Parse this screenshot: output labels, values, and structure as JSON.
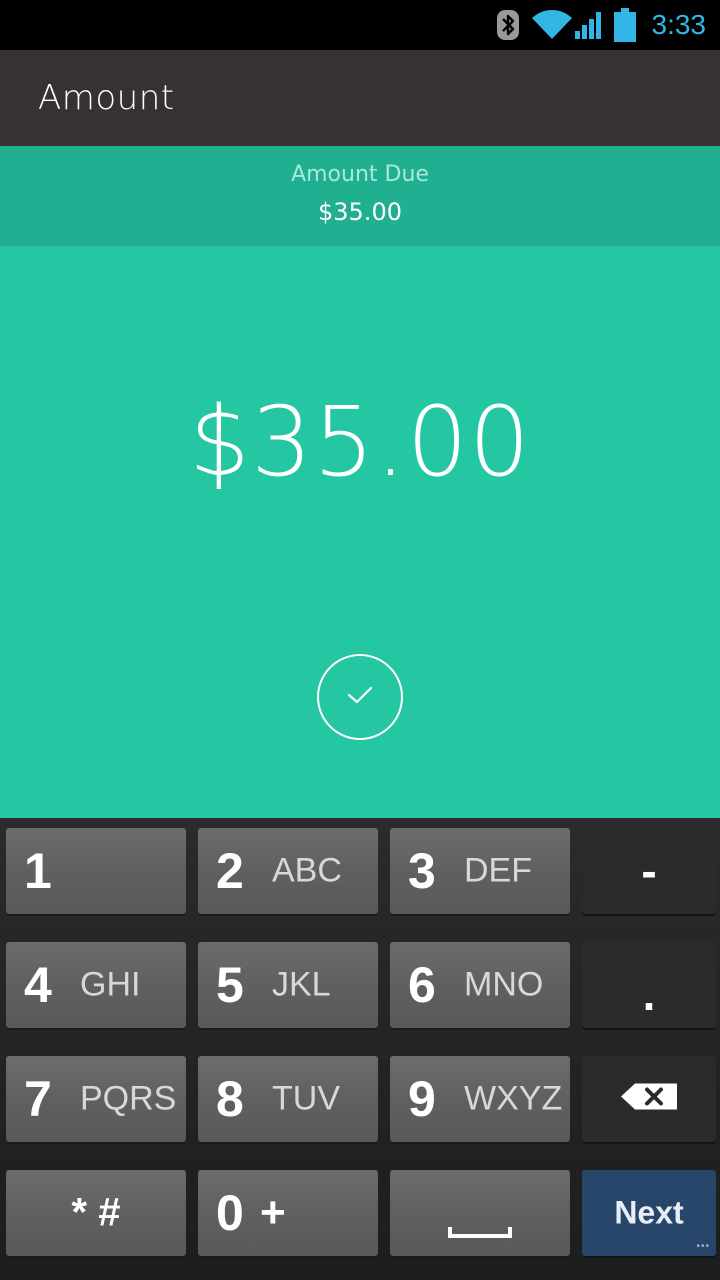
{
  "status_bar": {
    "time": "3:33",
    "icons": [
      "bluetooth-icon",
      "wifi-icon",
      "signal-icon",
      "battery-icon"
    ],
    "accent_color": "#33b5e5"
  },
  "app_bar": {
    "title": "Amount",
    "background": "#353135"
  },
  "amount_due": {
    "label": "Amount Due",
    "value": "$35.00"
  },
  "entry": {
    "amount": "$35.00",
    "confirm_icon": "checkmark-icon",
    "background": "#25c7a2"
  },
  "keypad": {
    "keys": [
      {
        "digit": "1",
        "letters": ""
      },
      {
        "digit": "2",
        "letters": "ABC"
      },
      {
        "digit": "3",
        "letters": "DEF"
      },
      {
        "symbol": "-"
      },
      {
        "digit": "4",
        "letters": "GHI"
      },
      {
        "digit": "5",
        "letters": "JKL"
      },
      {
        "digit": "6",
        "letters": "MNO"
      },
      {
        "symbol": "."
      },
      {
        "digit": "7",
        "letters": "PQRS"
      },
      {
        "digit": "8",
        "letters": "TUV"
      },
      {
        "digit": "9",
        "letters": "WXYZ"
      },
      {
        "icon": "backspace-icon"
      },
      {
        "symbol": "* #"
      },
      {
        "digit": "0",
        "letters": "+"
      },
      {
        "icon": "space-icon"
      },
      {
        "label": "Next"
      }
    ],
    "next_color": "#27466a"
  }
}
